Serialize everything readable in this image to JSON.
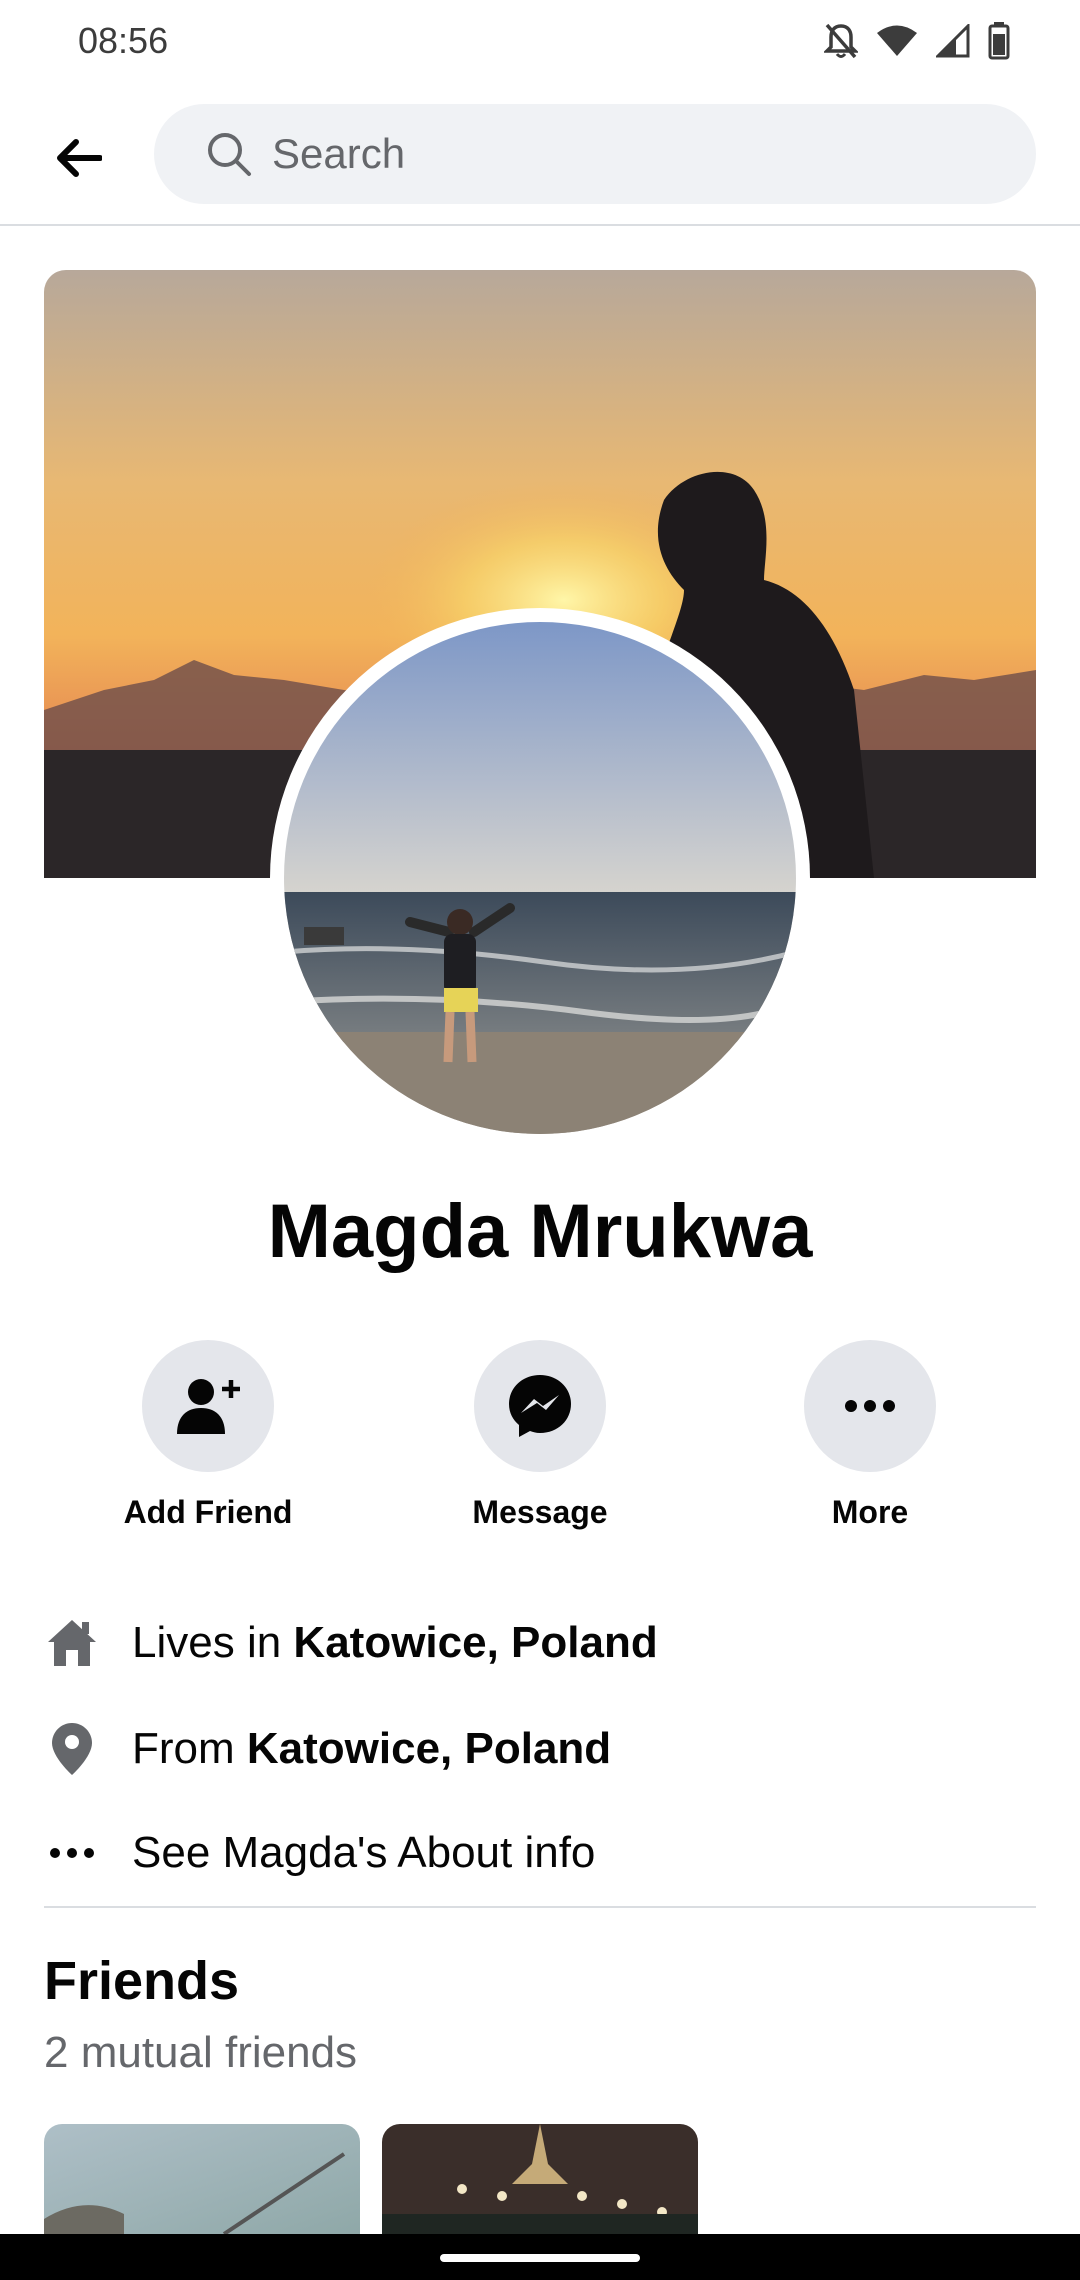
{
  "status": {
    "time": "08:56"
  },
  "search": {
    "placeholder": "Search"
  },
  "profile": {
    "name": "Magda Mrukwa"
  },
  "actions": [
    {
      "label": "Add Friend",
      "icon": "add-friend-icon"
    },
    {
      "label": "Message",
      "icon": "messenger-icon"
    },
    {
      "label": "More",
      "icon": "more-dots-icon"
    }
  ],
  "info": {
    "lives_prefix": "Lives in ",
    "lives_place": "Katowice, Poland",
    "from_prefix": "From ",
    "from_place": "Katowice, Poland",
    "about": "See Magda's About info"
  },
  "friends": {
    "title": "Friends",
    "subtitle": "2 mutual friends"
  },
  "colors": {
    "background": "#ffffff",
    "search_bg": "#f0f2f5",
    "button_bg": "#e4e6eb",
    "secondary_text": "#65676b"
  }
}
